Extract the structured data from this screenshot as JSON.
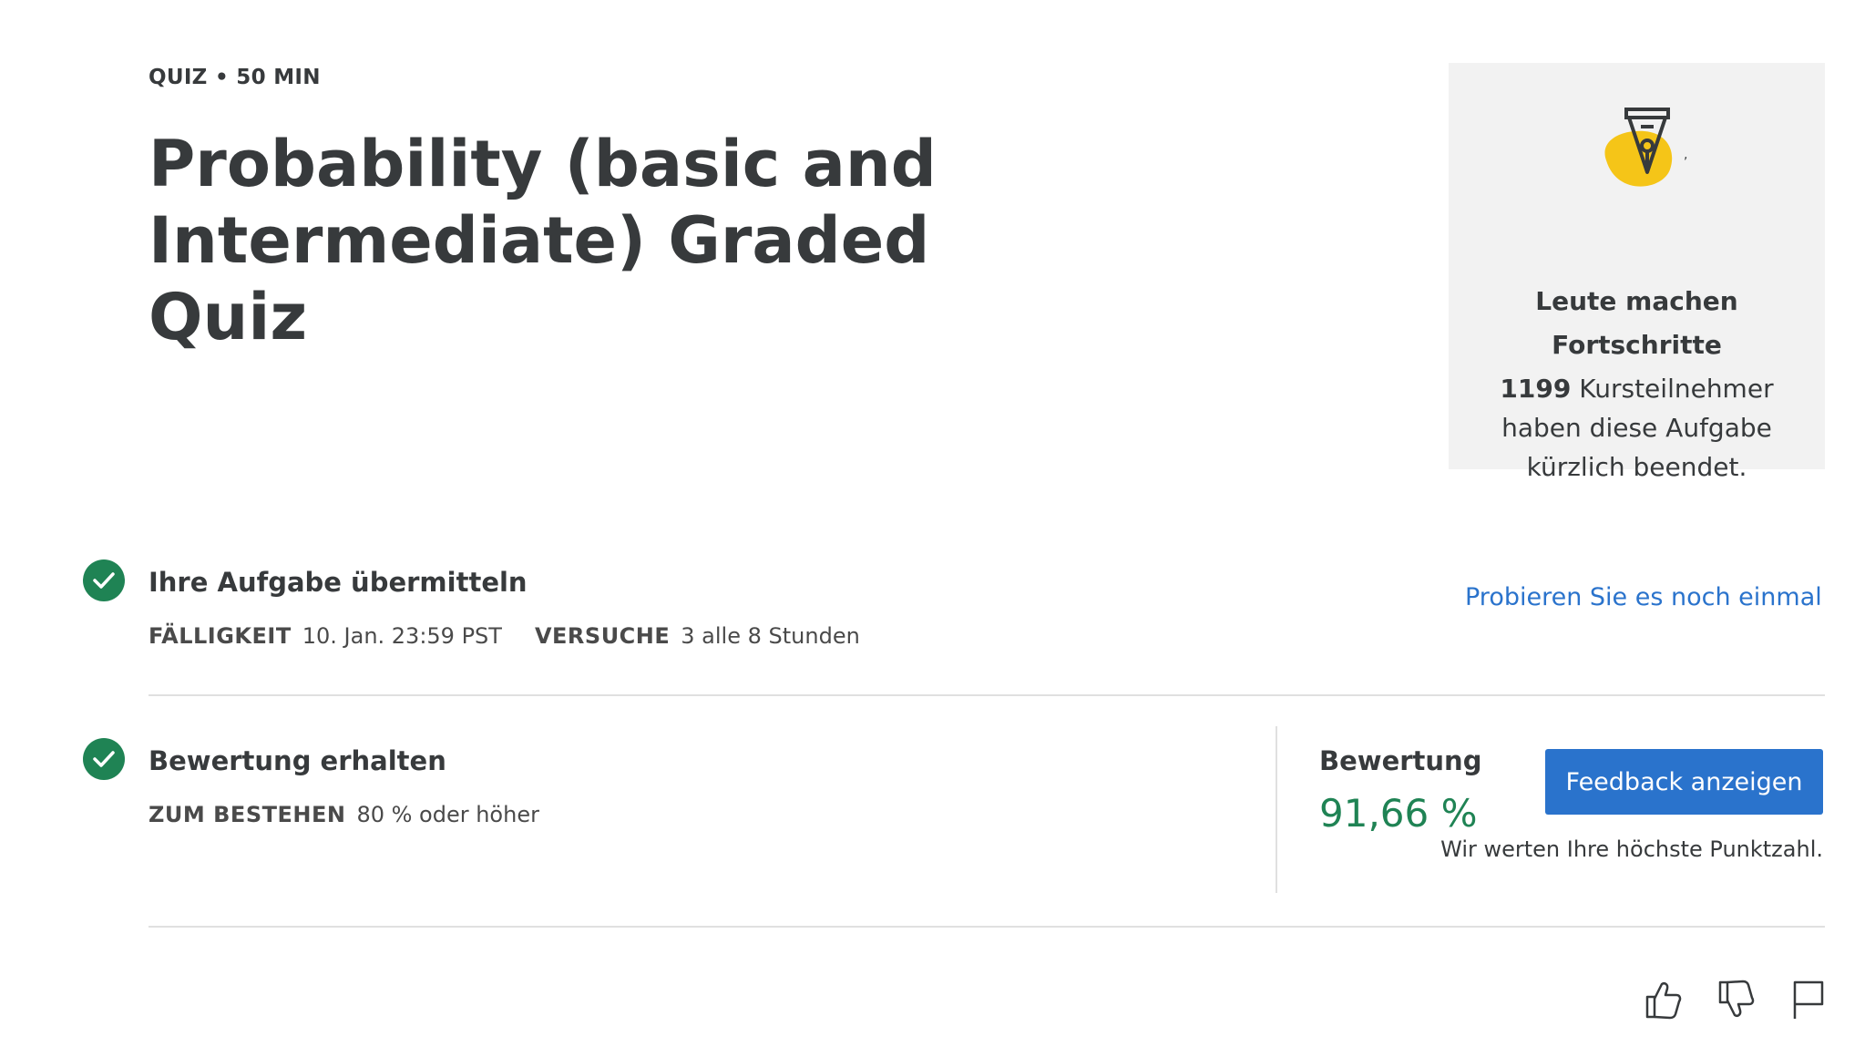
{
  "header": {
    "meta": "QUIZ • 50 MIN",
    "title": "Probability (basic and Intermediate) Graded Quiz"
  },
  "progress_card": {
    "icon": "pen-nib-icon",
    "heading": "Leute machen Fortschritte",
    "count": "1199",
    "text": "Kursteilnehmer haben diese Aufgabe kürzlich beendet."
  },
  "submit_section": {
    "title": "Ihre Aufgabe übermitteln",
    "due_label": "FÄLLIGKEIT",
    "due_value": "10. Jan. 23:59 PST",
    "attempts_label": "VERSUCHE",
    "attempts_value": "3 alle 8 Stunden",
    "retry_link": "Probieren Sie es noch einmal",
    "status_icon": "check-circle-icon"
  },
  "grade_section": {
    "title": "Bewertung erhalten",
    "pass_label": "ZUM BESTEHEN",
    "pass_value": "80 % oder höher",
    "grade_label": "Bewertung",
    "grade_value": "91,66 %",
    "feedback_button": "Feedback anzeigen",
    "note": "Wir werten Ihre höchste Punktzahl.",
    "status_icon": "check-circle-icon"
  },
  "footer": {
    "icons": [
      "thumbs-up-icon",
      "thumbs-down-icon",
      "flag-icon"
    ]
  },
  "colors": {
    "success": "#1f8354",
    "accent": "#2a73cc",
    "highlight": "#f5c518",
    "card_bg": "#f2f2f2"
  }
}
